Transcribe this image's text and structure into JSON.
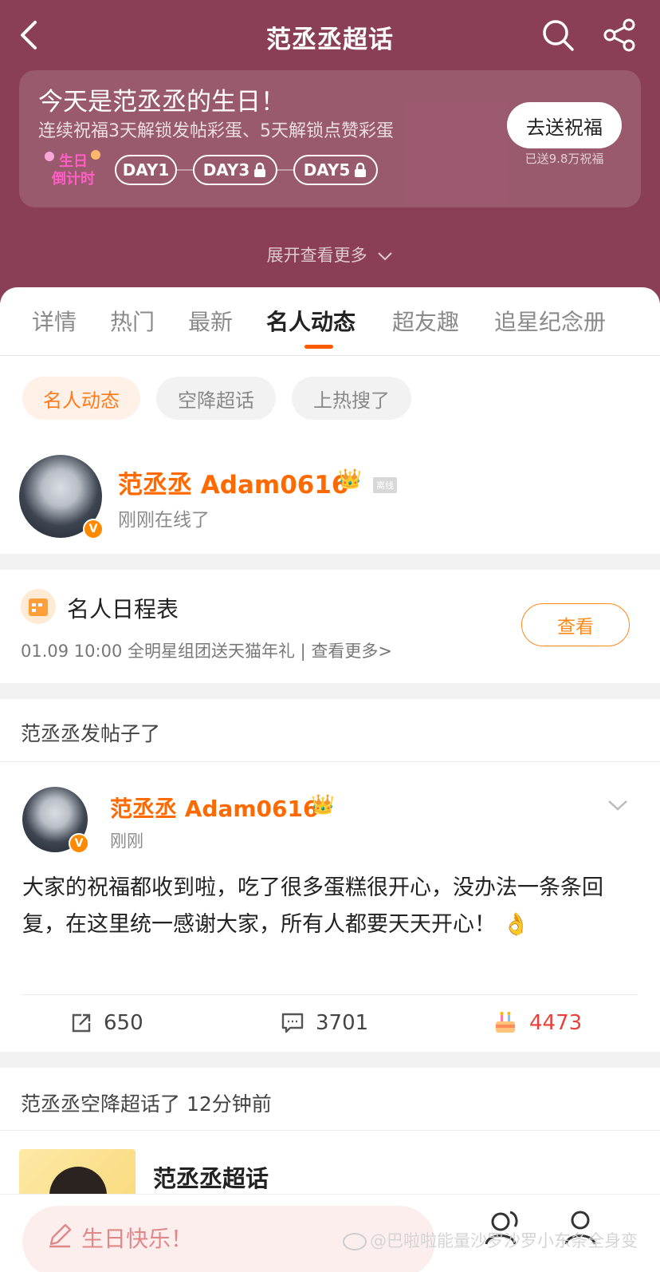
{
  "header": {
    "title": "范丞丞超话",
    "birthday": {
      "title": "今天是范丞丞的生日！",
      "subtitle": "连续祝福3天解锁发帖彩蛋、5天解锁点赞彩蛋",
      "logo_text": "生日倒计时",
      "days": [
        "DAY1",
        "DAY3",
        "DAY5"
      ],
      "send_button": "去送祝福",
      "sent_count": "已送9.8万祝福"
    },
    "expand_more": "展开查看更多"
  },
  "tabs": [
    "详情",
    "热门",
    "最新",
    "名人动态",
    "超友趣",
    "追星纪念册"
  ],
  "chips": [
    "名人动态",
    "空降超话",
    "上热搜了"
  ],
  "celebrity": {
    "name": "范丞丞 Adam0616",
    "offline_tag": "离线",
    "status": "刚刚在线了"
  },
  "schedule": {
    "title": "名人日程表",
    "line": "01.09 10:00 全明星组团送天猫年礼 |  查看更多>",
    "view_button": "查看"
  },
  "post_section": {
    "title": "范丞丞发帖子了",
    "author": "范丞丞 Adam0616",
    "time": "刚刚",
    "content": "大家的祝福都收到啦，吃了很多蛋糕很开心，没办法一条条回复，在这里统一感谢大家，所有人都要天天开心！ 👌",
    "reposts": "650",
    "comments": "3701",
    "likes": "4473"
  },
  "airdrop_section": {
    "title": "范丞丞空降超话了 12分钟前",
    "topic_name": "范丞丞超话"
  },
  "bottom_bar": {
    "compose_text": "生日快乐！",
    "watermark": "@巴啦啦能量沙罗沙罗小东条全身变"
  },
  "colors": {
    "header_bg": "#8a3f57",
    "accent_orange": "#ff6a00",
    "like_red": "#e8403a"
  }
}
